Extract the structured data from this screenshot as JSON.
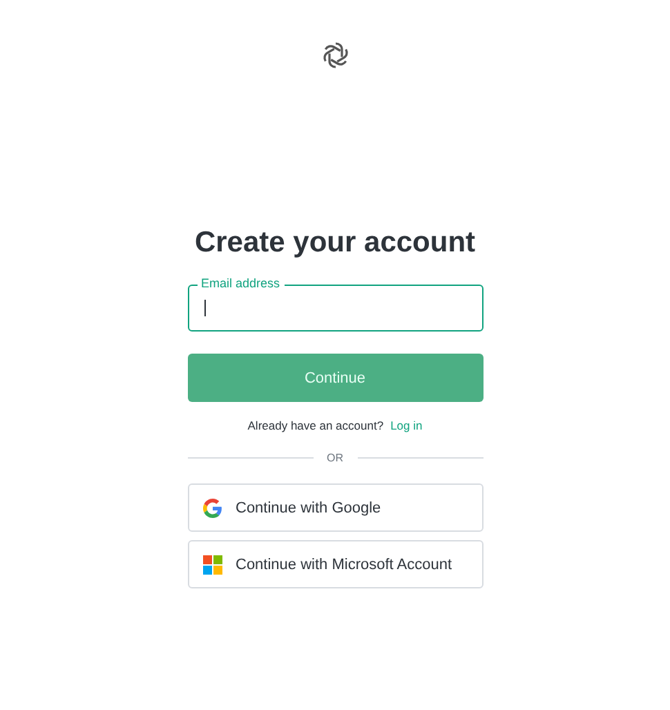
{
  "heading": "Create your account",
  "email_field": {
    "label": "Email address",
    "focused": true
  },
  "continue_button": "Continue",
  "login_prompt": {
    "text": "Already have an account?",
    "link": "Log in"
  },
  "divider": "OR",
  "social_buttons": [
    {
      "kind": "google",
      "label": "Continue with Google"
    },
    {
      "kind": "microsoft",
      "label": "Continue with Microsoft Account"
    }
  ]
}
